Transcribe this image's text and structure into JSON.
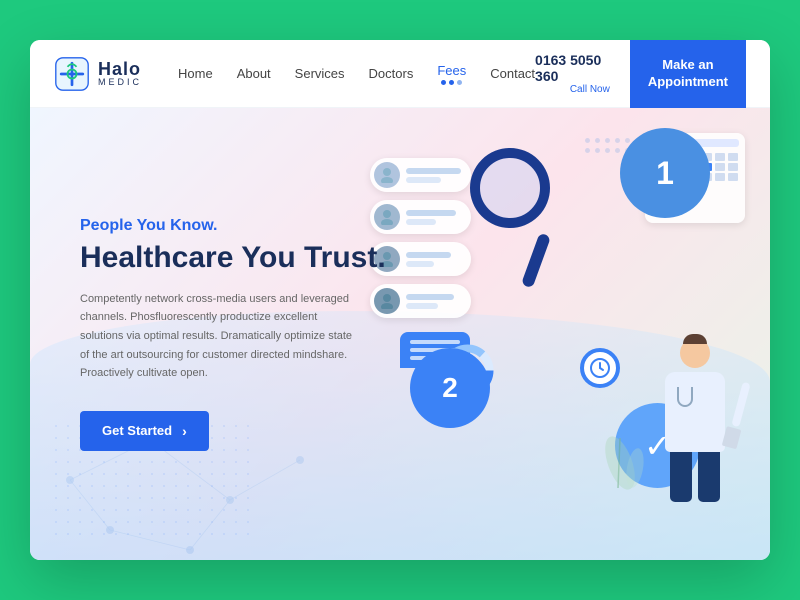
{
  "site": {
    "name": "Halo",
    "sub": "MEDIC"
  },
  "nav": {
    "links": [
      {
        "label": "Home",
        "active": false
      },
      {
        "label": "About",
        "active": false
      },
      {
        "label": "Services",
        "active": false
      },
      {
        "label": "Doctors",
        "active": false
      },
      {
        "label": "Fees",
        "active": true
      },
      {
        "label": "Contact",
        "active": false
      }
    ],
    "phone": "0163 5050 360",
    "phone_label": "Call Now",
    "cta_line1": "Make an",
    "cta_line2": "Appointment"
  },
  "hero": {
    "sub_title": "People You Know.",
    "title": "Healthcare You Trust.",
    "description": "Competently network cross-media users and leveraged channels. Phosfluorescently productize excellent solutions via optimal results. Dramatically optimize state of the art outsourcing for customer directed mindshare. Proactively cultivate open.",
    "cta_label": "Get Started",
    "cta_arrow": "›"
  },
  "illustration": {
    "circle1_number": "1",
    "circle2_number": "2"
  }
}
